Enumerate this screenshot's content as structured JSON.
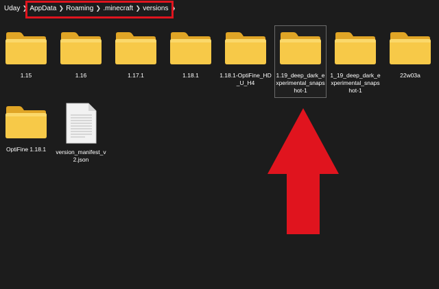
{
  "breadcrumb": {
    "root": "Uday",
    "items": [
      "AppData",
      "Roaming",
      ".minecraft",
      "versions"
    ]
  },
  "items": [
    {
      "label": "1.15",
      "type": "folder"
    },
    {
      "label": "1.16",
      "type": "folder"
    },
    {
      "label": "1.17.1",
      "type": "folder"
    },
    {
      "label": "1.18.1",
      "type": "folder"
    },
    {
      "label": "1.18.1-OptiFine_HD_U_H4",
      "type": "folder"
    },
    {
      "label": "1.19_deep_dark_experimental_snapshot-1",
      "type": "folder",
      "selected": true
    },
    {
      "label": "1_19_deep_dark_experimental_snapshot-1",
      "type": "folder"
    },
    {
      "label": "22w03a",
      "type": "folder"
    },
    {
      "label": "OptiFine 1.18.1",
      "type": "folder"
    },
    {
      "label": "version_manifest_v2.json",
      "type": "file"
    }
  ],
  "colors": {
    "background": "#1c1c1c",
    "folder_front": "#f7c948",
    "folder_back": "#e0a526",
    "annotation_red": "#e0141e"
  },
  "icons": {
    "folder": "folder-icon",
    "file": "json-file-icon",
    "chevron": "chevron-right-icon"
  }
}
